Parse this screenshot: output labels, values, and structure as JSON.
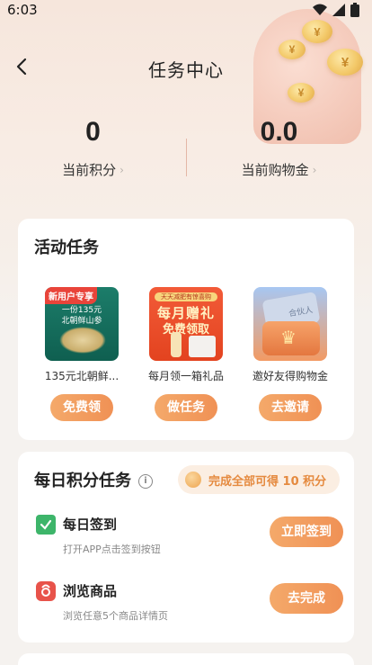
{
  "status": {
    "time": "6:03"
  },
  "nav": {
    "title": "任务中心"
  },
  "stats": {
    "points": {
      "value": "0",
      "label": "当前积分"
    },
    "cash": {
      "value": "0.0",
      "label": "当前购物金"
    }
  },
  "activities": {
    "title": "活动任务",
    "items": [
      {
        "tag": "新用户专享",
        "image_caption": "一份135元\n北朝鲜山参",
        "name": "135元北朝鲜...",
        "button": "免费领"
      },
      {
        "image_banner": "天天减肥有惊喜购",
        "image_headline": "每月赠礼",
        "image_subline": "免费领取",
        "name": "每月领一箱礼品",
        "button": "做任务"
      },
      {
        "image_label": "合伙人",
        "name": "邀好友得购物金",
        "button": "去邀请"
      }
    ]
  },
  "daily": {
    "title": "每日积分任务",
    "info_icon": "i",
    "reward_text": "完成全部可得 10 积分",
    "tasks": [
      {
        "icon": "calendar-check-icon",
        "title": "每日签到",
        "desc": "打开APP点击签到按钮",
        "button": "立即签到"
      },
      {
        "icon": "shopping-bag-icon",
        "title": "浏览商品",
        "desc": "浏览任意5个商品详情页",
        "button": "去完成"
      }
    ]
  },
  "colors": {
    "accent": "#f09155",
    "reward": "#e58a3f",
    "divider": "#e4b7a7"
  }
}
